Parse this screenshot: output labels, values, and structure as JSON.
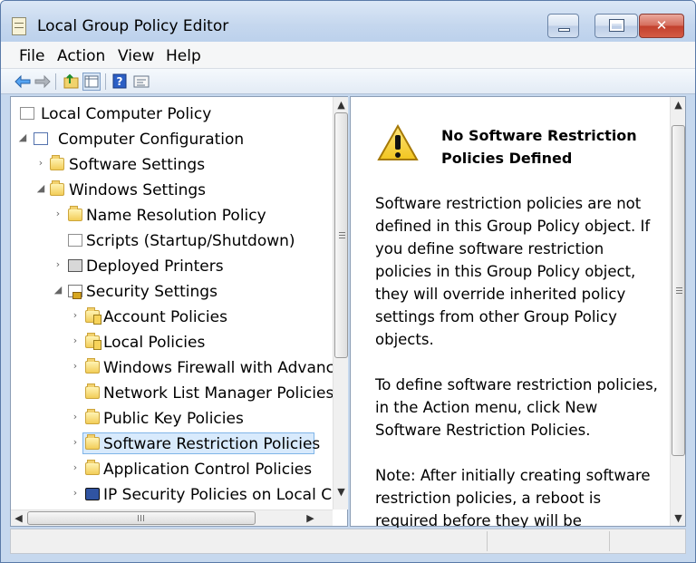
{
  "window": {
    "title": "Local Group Policy Editor",
    "controls": {
      "minimize": "minimize-icon",
      "maximize": "maximize-icon",
      "close": "close-icon"
    }
  },
  "menu": {
    "file": "File",
    "action": "Action",
    "view": "View",
    "help": "Help"
  },
  "toolbar": {
    "icons": [
      "back-arrow-icon",
      "forward-arrow-icon",
      "up-folder-icon",
      "show-hide-console-tree-icon",
      "help-icon",
      "properties-icon"
    ]
  },
  "tree": {
    "items": [
      {
        "label": "Local Computer Policy",
        "icon": "policy-document-icon",
        "expander": ""
      },
      {
        "label": "Computer Configuration",
        "icon": "computer-icon",
        "expander": "◢"
      },
      {
        "label": "Software Settings",
        "icon": "folder-icon",
        "expander": "›"
      },
      {
        "label": "Windows Settings",
        "icon": "folder-icon",
        "expander": "◢"
      },
      {
        "label": "Name Resolution Policy",
        "icon": "folder-icon",
        "expander": "›"
      },
      {
        "label": "Scripts (Startup/Shutdown)",
        "icon": "script-icon",
        "expander": ""
      },
      {
        "label": "Deployed Printers",
        "icon": "printer-icon",
        "expander": "›"
      },
      {
        "label": "Security Settings",
        "icon": "security-settings-icon",
        "expander": "◢"
      },
      {
        "label": "Account Policies",
        "icon": "policy-folder-icon",
        "expander": "›"
      },
      {
        "label": "Local Policies",
        "icon": "policy-folder-icon",
        "expander": "›"
      },
      {
        "label": "Windows Firewall with Advance",
        "icon": "folder-icon",
        "expander": "›"
      },
      {
        "label": "Network List Manager Policies",
        "icon": "folder-icon",
        "expander": ""
      },
      {
        "label": "Public Key Policies",
        "icon": "folder-icon",
        "expander": "›"
      },
      {
        "label": "Software Restriction Policies",
        "icon": "folder-icon",
        "expander": "›",
        "selected": true
      },
      {
        "label": "Application Control Policies",
        "icon": "folder-icon",
        "expander": "›"
      },
      {
        "label": "IP Security Policies on Local Co",
        "icon": "ip-security-icon",
        "expander": "›"
      }
    ]
  },
  "details": {
    "warning_icon": "warning-icon",
    "title": "No Software Restriction Policies Defined",
    "body": "Software restriction policies are not defined in this Group Policy object. If you define software restriction policies in this Group Policy object, they will override inherited policy settings from other Group Policy objects.\n\nTo define software restriction policies, in the Action menu, click New Software Restriction Policies.\n\nNote: After initially creating software restriction policies, a reboot is required before they will be"
  },
  "scrollbars": {
    "up_arrow": "▲",
    "down_arrow": "▼",
    "left_arrow": "◀",
    "right_arrow": "▶"
  }
}
